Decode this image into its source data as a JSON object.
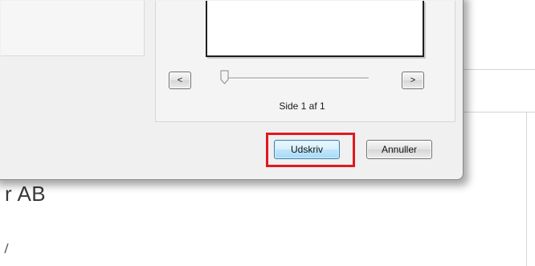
{
  "window": {
    "preview": {
      "page_indicator": "Side 1 af 1",
      "prev_label": "<",
      "next_label": ">",
      "zoom_level": 0
    },
    "buttons": {
      "print_label": "Udskriv",
      "cancel_label": "Annuller"
    }
  },
  "background_document": {
    "visible_text": "r AB"
  },
  "annotation": {
    "highlight_color": "#e1191f",
    "target": "print-button"
  }
}
